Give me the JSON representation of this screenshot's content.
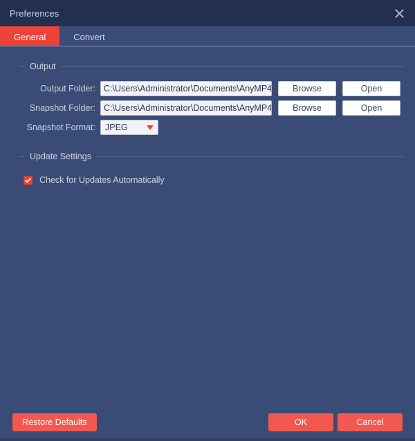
{
  "window": {
    "title": "Preferences",
    "close_icon": "close-icon"
  },
  "tabs": [
    {
      "label": "General",
      "active": true
    },
    {
      "label": "Convert",
      "active": false
    }
  ],
  "groups": {
    "output": {
      "title": "Output",
      "rows": [
        {
          "label": "Output Folder:",
          "value": "C:\\Users\\Administrator\\Documents\\AnyMP4",
          "browse_label": "Browse",
          "open_label": "Open"
        },
        {
          "label": "Snapshot Folder:",
          "value": "C:\\Users\\Administrator\\Documents\\AnyMP4",
          "browse_label": "Browse",
          "open_label": "Open"
        }
      ],
      "snapshot_format": {
        "label": "Snapshot Format:",
        "value": "JPEG",
        "caret_icon": "chevron-down-icon"
      }
    },
    "update": {
      "title": "Update Settings",
      "checkbox": {
        "label": "Check for Updates Automatically",
        "checked": true,
        "check_icon": "checkmark-icon"
      }
    }
  },
  "footer": {
    "restore_label": "Restore Defaults",
    "ok_label": "OK",
    "cancel_label": "Cancel"
  },
  "colors": {
    "window_bg": "#3a4c75",
    "titlebar_bg": "#222f4e",
    "accent_red": "#ec4339",
    "button_red": "#f2584f",
    "field_bg": "#f2f3f7",
    "text": "#cdd4e3"
  }
}
